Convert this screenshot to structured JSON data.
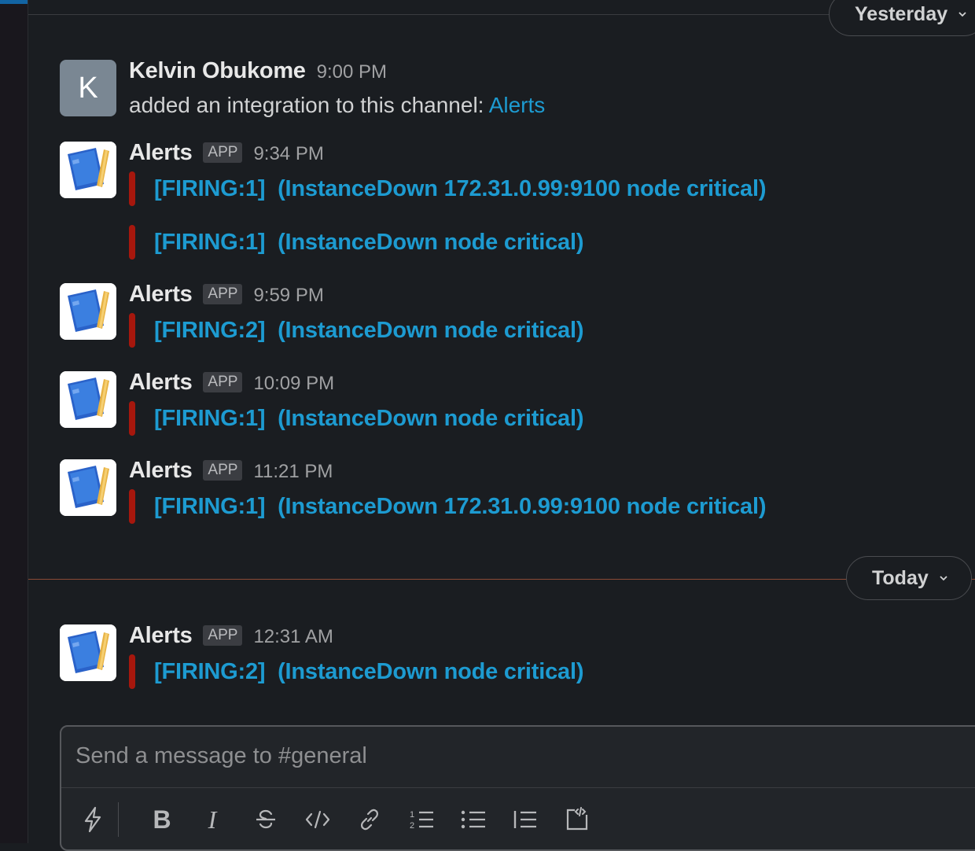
{
  "dividers": {
    "yesterday": "Yesterday",
    "today": "Today"
  },
  "messages": [
    {
      "avatar_letter": "K",
      "sender": "Kelvin Obukome",
      "time": "9:00 PM",
      "text": "added an integration to this channel: ",
      "link": "Alerts"
    },
    {
      "sender": "Alerts",
      "badge": "APP",
      "time": "9:34 PM",
      "alerts": [
        "[FIRING:1]  (InstanceDown 172.31.0.99:9100 node critical)",
        "[FIRING:1]  (InstanceDown node critical)"
      ]
    },
    {
      "sender": "Alerts",
      "badge": "APP",
      "time": "9:59 PM",
      "alerts": [
        "[FIRING:2]  (InstanceDown node critical)"
      ]
    },
    {
      "sender": "Alerts",
      "badge": "APP",
      "time": "10:09 PM",
      "alerts": [
        "[FIRING:1]  (InstanceDown node critical)"
      ]
    },
    {
      "sender": "Alerts",
      "badge": "APP",
      "time": "11:21 PM",
      "alerts": [
        "[FIRING:1]  (InstanceDown 172.31.0.99:9100 node critical)"
      ]
    },
    {
      "sender": "Alerts",
      "badge": "APP",
      "time": "12:31 AM",
      "alerts": [
        "[FIRING:2]  (InstanceDown node critical)"
      ]
    }
  ],
  "composer": {
    "placeholder": "Send a message to #general",
    "tools": [
      "shortcuts-icon",
      "bold-icon",
      "italic-icon",
      "strikethrough-icon",
      "code-icon",
      "link-icon",
      "numbered-list-icon",
      "bulleted-list-icon",
      "blockquote-icon",
      "code-block-icon"
    ],
    "bold_glyph": "B",
    "italic_glyph": "I"
  },
  "colors": {
    "background": "#1a1d21",
    "link": "#1d9bd1",
    "alert_bar": "#a6170d",
    "today_line": "#8b4a36"
  }
}
